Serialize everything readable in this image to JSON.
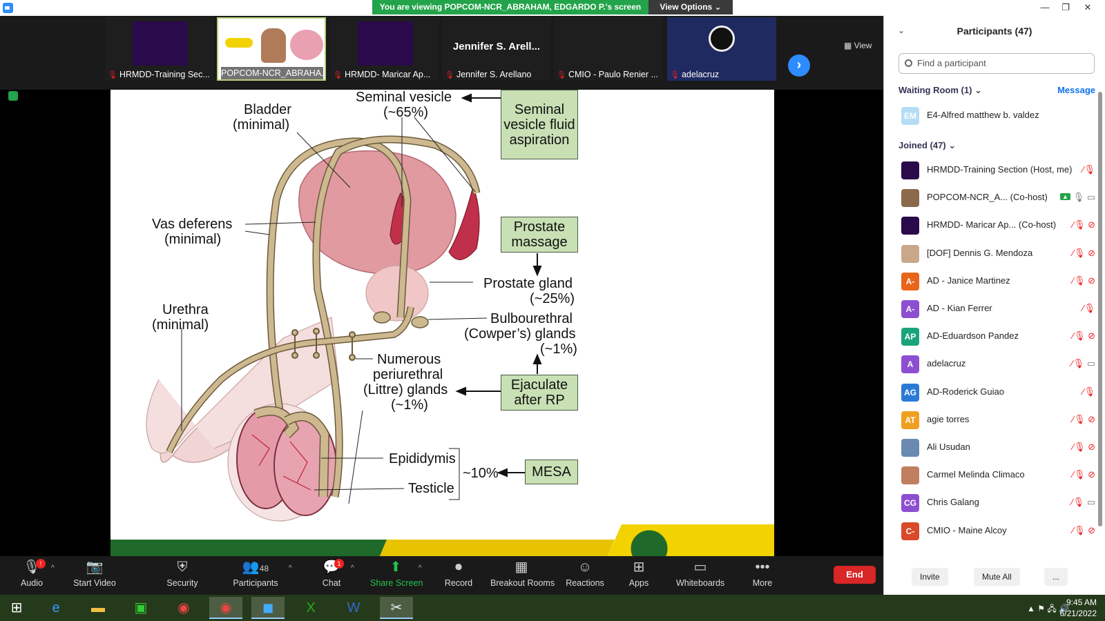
{
  "topbar": {
    "banner": "You are viewing POPCOM-NCR_ABRAHAM, EDGARDO P.'s screen",
    "view_options": "View Options ⌄"
  },
  "strip": {
    "tiles": [
      {
        "name": "HRMDD-Training Sec...",
        "muted": true
      },
      {
        "name": "POPCOM-NCR_ABRAHA...",
        "muted": false
      },
      {
        "name": "HRMDD- Maricar Ap...",
        "muted": true
      },
      {
        "name": "Jennifer S. Arellano",
        "big": "Jennifer S. Arell...",
        "muted": true
      },
      {
        "name": "CMIO - Paulo Renier ...",
        "muted": true
      },
      {
        "name": "adelacruz",
        "muted": true
      }
    ],
    "view_label": "View"
  },
  "slide": {
    "labels": {
      "seminal_vesicle": "Seminal vesicle",
      "seminal_vesicle_pct": "(~65%)",
      "bladder": "Bladder",
      "bladder_sub": "(minimal)",
      "vas": "Vas deferens",
      "vas_sub": "(minimal)",
      "urethra": "Urethra",
      "urethra_sub": "(minimal)",
      "prostate": "Prostate gland",
      "prostate_pct": "(~25%)",
      "bulbo": "Bulbourethral",
      "bulbo2": "(Cowper’s) glands",
      "bulbo_pct": "(~1%)",
      "littre1": "Numerous",
      "littre2": "periurethral",
      "littre3": "(Littre) glands",
      "littre_pct": "(~1%)",
      "epididymis": "Epididymis",
      "testicle": "Testicle",
      "pct10": "~10%"
    },
    "boxes": {
      "svfa": "Seminal vesicle fluid aspiration",
      "massage": "Prostate massage",
      "ejaculate": "Ejaculate after RP",
      "mesa": "MESA"
    }
  },
  "panel": {
    "title": "Participants (47)",
    "search_placeholder": "Find a participant",
    "waiting_head": "Waiting Room (1)  ⌄",
    "message": "Message",
    "waiting": [
      {
        "initials": "EM",
        "name": "E4-Alfred matthew b. valdez",
        "color": "#b7dcf5"
      }
    ],
    "joined_head": "Joined (47)  ⌄",
    "joined": [
      {
        "initials": "",
        "name": "HRMDD-Training Section (Host, me)",
        "color": "#2a0a4a",
        "icons": "mute"
      },
      {
        "initials": "",
        "name": "POPCOM-NCR_A...  (Co-host)",
        "color": "#8a6a4a",
        "icons": "share"
      },
      {
        "initials": "",
        "name": "HRMDD- Maricar Ap...  (Co-host)",
        "color": "#2a0a4a",
        "icons": "both"
      },
      {
        "initials": "",
        "name": "[DOF] Dennis G. Mendoza",
        "color": "#c9a88a",
        "icons": "both"
      },
      {
        "initials": "A-",
        "name": "AD - Janice Martinez",
        "color": "#e8651a",
        "icons": "both"
      },
      {
        "initials": "A-",
        "name": "AD - Kian Ferrer",
        "color": "#8d4fd1",
        "icons": "mute"
      },
      {
        "initials": "AP",
        "name": "AD-Eduardson Pandez",
        "color": "#1aa37a",
        "icons": "both"
      },
      {
        "initials": "A",
        "name": "adelacruz",
        "color": "#8d4fd1",
        "icons": "mutecam"
      },
      {
        "initials": "AG",
        "name": "AD-Roderick Guiao",
        "color": "#2b7bd6",
        "icons": "mute"
      },
      {
        "initials": "AT",
        "name": "agie torres",
        "color": "#f0a020",
        "icons": "both"
      },
      {
        "initials": "",
        "name": "Ali Usudan",
        "color": "#6a8ab0",
        "icons": "both"
      },
      {
        "initials": "",
        "name": "Carmel Melinda Climaco",
        "color": "#c08060",
        "icons": "both"
      },
      {
        "initials": "CG",
        "name": "Chris Galang",
        "color": "#8d4fd1",
        "icons": "mutecam"
      },
      {
        "initials": "C-",
        "name": "CMIO - Maine Alcoy",
        "color": "#d94a2a",
        "icons": "both"
      }
    ],
    "invite": "Invite",
    "mute_all": "Mute All",
    "more": "..."
  },
  "controls": {
    "audio": "Audio",
    "start_video": "Start Video",
    "security": "Security",
    "participants": "Participants",
    "participants_count": "48",
    "chat": "Chat",
    "chat_badge": "1",
    "audio_badge": "!",
    "share_screen": "Share Screen",
    "record": "Record",
    "breakout": "Breakout Rooms",
    "reactions": "Reactions",
    "apps": "Apps",
    "whiteboards": "Whiteboards",
    "more": "More",
    "end": "End"
  },
  "taskbar": {
    "time": "9:45 AM",
    "date": "6/21/2022"
  }
}
